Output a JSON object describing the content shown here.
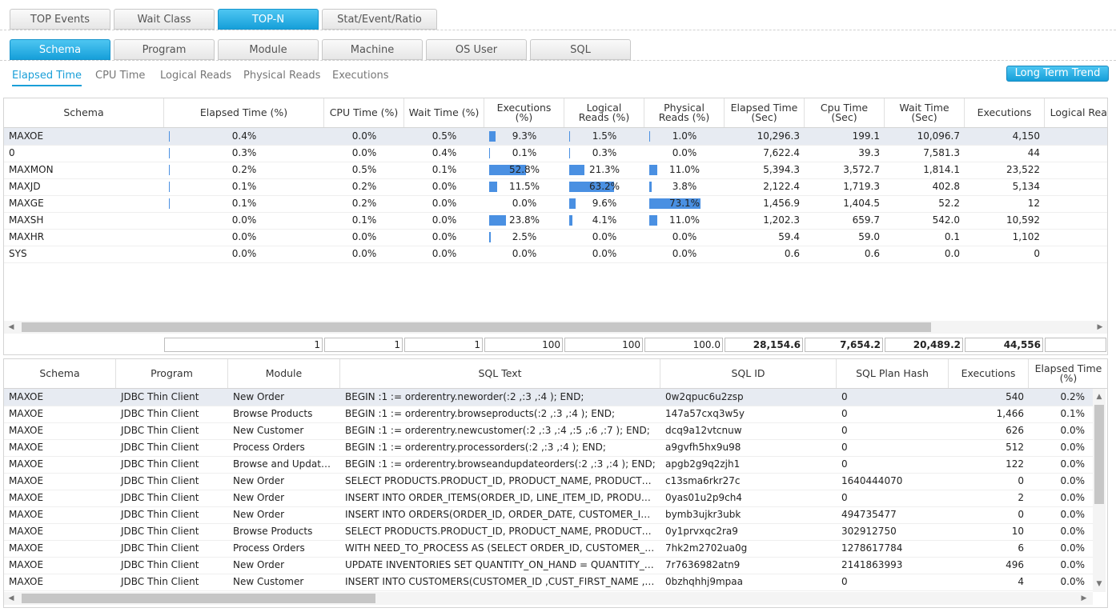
{
  "top_tabs": [
    "TOP Events",
    "Wait Class",
    "TOP-N",
    "Stat/Event/Ratio"
  ],
  "top_active": 2,
  "group_tabs": [
    "Schema",
    "Program",
    "Module",
    "Machine",
    "OS User",
    "SQL"
  ],
  "group_active": 0,
  "metric_tabs": [
    "Elapsed Time",
    "CPU Time",
    "Logical Reads",
    "Physical Reads",
    "Executions"
  ],
  "metric_active": 0,
  "long_term_trend": "Long Term Trend",
  "accent_color": "#1a9fd8",
  "bar_color": "#4a90e2",
  "schema_grid": {
    "columns": [
      "Schema",
      "Elapsed Time (%)",
      "CPU Time (%)",
      "Wait Time (%)",
      "Executions\n(%)",
      "Logical\nReads (%)",
      "Physical\nReads (%)",
      "Elapsed Time\n(Sec)",
      "Cpu Time\n(Sec)",
      "Wait Time\n(Sec)",
      "Executions",
      "Logical Reads"
    ],
    "rows": [
      {
        "schema": "MAXOE",
        "elapsed": "0.4%",
        "elapsed_v": 0.4,
        "cpu": "0.0%",
        "wait": "0.5%",
        "exec_pct": "9.3%",
        "exec_v": 9.3,
        "lr_pct": "1.5%",
        "lr_v": 1.5,
        "pr_pct": "1.0%",
        "pr_v": 1.0,
        "elapsed_sec": "10,296.3",
        "cpu_sec": "199.1",
        "wait_sec": "10,096.7",
        "executions": "4,150"
      },
      {
        "schema": "0",
        "elapsed": "0.3%",
        "elapsed_v": 0.3,
        "cpu": "0.0%",
        "wait": "0.4%",
        "exec_pct": "0.1%",
        "exec_v": 0.1,
        "lr_pct": "0.3%",
        "lr_v": 0.3,
        "pr_pct": "0.0%",
        "pr_v": 0,
        "elapsed_sec": "7,622.4",
        "cpu_sec": "39.3",
        "wait_sec": "7,581.3",
        "executions": "44"
      },
      {
        "schema": "MAXMON",
        "elapsed": "0.2%",
        "elapsed_v": 0.2,
        "cpu": "0.5%",
        "wait": "0.1%",
        "exec_pct": "52.8%",
        "exec_v": 52.8,
        "lr_pct": "21.3%",
        "lr_v": 21.3,
        "pr_pct": "11.0%",
        "pr_v": 11.0,
        "elapsed_sec": "5,394.3",
        "cpu_sec": "3,572.7",
        "wait_sec": "1,814.1",
        "executions": "23,522"
      },
      {
        "schema": "MAXJD",
        "elapsed": "0.1%",
        "elapsed_v": 0.1,
        "cpu": "0.2%",
        "wait": "0.0%",
        "exec_pct": "11.5%",
        "exec_v": 11.5,
        "lr_pct": "63.2%",
        "lr_v": 63.2,
        "pr_pct": "3.8%",
        "pr_v": 3.8,
        "elapsed_sec": "2,122.4",
        "cpu_sec": "1,719.3",
        "wait_sec": "402.8",
        "executions": "5,134"
      },
      {
        "schema": "MAXGE",
        "elapsed": "0.1%",
        "elapsed_v": 0.1,
        "cpu": "0.2%",
        "wait": "0.0%",
        "exec_pct": "0.0%",
        "exec_v": 0,
        "lr_pct": "9.6%",
        "lr_v": 9.6,
        "pr_pct": "73.1%",
        "pr_v": 73.1,
        "elapsed_sec": "1,456.9",
        "cpu_sec": "1,404.5",
        "wait_sec": "52.2",
        "executions": "12"
      },
      {
        "schema": "MAXSH",
        "elapsed": "0.0%",
        "elapsed_v": 0,
        "cpu": "0.1%",
        "wait": "0.0%",
        "exec_pct": "23.8%",
        "exec_v": 23.8,
        "lr_pct": "4.1%",
        "lr_v": 4.1,
        "pr_pct": "11.0%",
        "pr_v": 11.0,
        "elapsed_sec": "1,202.3",
        "cpu_sec": "659.7",
        "wait_sec": "542.0",
        "executions": "10,592"
      },
      {
        "schema": "MAXHR",
        "elapsed": "0.0%",
        "elapsed_v": 0,
        "cpu": "0.0%",
        "wait": "0.0%",
        "exec_pct": "2.5%",
        "exec_v": 2.5,
        "lr_pct": "0.0%",
        "lr_v": 0,
        "pr_pct": "0.0%",
        "pr_v": 0,
        "elapsed_sec": "59.4",
        "cpu_sec": "59.0",
        "wait_sec": "0.1",
        "executions": "1,102"
      },
      {
        "schema": "SYS",
        "elapsed": "0.0%",
        "elapsed_v": 0,
        "cpu": "0.0%",
        "wait": "0.0%",
        "exec_pct": "0.0%",
        "exec_v": 0,
        "lr_pct": "0.0%",
        "lr_v": 0,
        "pr_pct": "0.0%",
        "pr_v": 0,
        "elapsed_sec": "0.6",
        "cpu_sec": "0.6",
        "wait_sec": "0.0",
        "executions": "0"
      }
    ],
    "selected_row": 0,
    "totals": [
      "1",
      "1",
      "1",
      "100",
      "100",
      "100.0",
      "28,154.6",
      "7,654.2",
      "20,489.2",
      "44,556",
      ""
    ]
  },
  "sql_grid": {
    "columns": [
      "Schema",
      "Program",
      "Module",
      "SQL Text",
      "SQL ID",
      "SQL Plan Hash",
      "Executions",
      "Elapsed Time\n(%)"
    ],
    "rows": [
      [
        "MAXOE",
        "JDBC Thin Client",
        "New Order",
        "BEGIN :1 := orderentry.neworder(:2 ,:3 ,:4 ); END;",
        "0w2qpuc6u2zsp",
        "0",
        "540",
        "0.2%"
      ],
      [
        "MAXOE",
        "JDBC Thin Client",
        "Browse Products",
        "BEGIN :1 := orderentry.browseproducts(:2 ,:3 ,:4 ); END;",
        "147a57cxq3w5y",
        "0",
        "1,466",
        "0.1%"
      ],
      [
        "MAXOE",
        "JDBC Thin Client",
        "New Customer",
        "BEGIN :1 := orderentry.newcustomer(:2 ,:3 ,:4 ,:5 ,:6 ,:7 ); END;",
        "dcq9a12vtcnuw",
        "0",
        "626",
        "0.0%"
      ],
      [
        "MAXOE",
        "JDBC Thin Client",
        "Process Orders",
        "BEGIN :1 := orderentry.processorders(:2 ,:3 ,:4 ); END;",
        "a9gvfh5hx9u98",
        "0",
        "512",
        "0.0%"
      ],
      [
        "MAXOE",
        "JDBC Thin Client",
        "Browse and Update O...",
        "BEGIN :1 := orderentry.browseandupdateorders(:2 ,:3 ,:4 ); END;",
        "apgb2g9q2zjh1",
        "0",
        "122",
        "0.0%"
      ],
      [
        "MAXOE",
        "JDBC Thin Client",
        "New Order",
        "SELECT PRODUCTS.PRODUCT_ID, PRODUCT_NAME, PRODUCT_DESCRI...",
        "c13sma6rkr27c",
        "1640444070",
        "0",
        "0.0%"
      ],
      [
        "MAXOE",
        "JDBC Thin Client",
        "New Order",
        "INSERT INTO ORDER_ITEMS(ORDER_ID, LINE_ITEM_ID, PRODUCT_ID, U...",
        "0yas01u2p9ch4",
        "0",
        "2",
        "0.0%"
      ],
      [
        "MAXOE",
        "JDBC Thin Client",
        "New Order",
        "INSERT INTO ORDERS(ORDER_ID, ORDER_DATE, CUSTOMER_ID, WARE...",
        "bymb3ujkr3ubk",
        "494735477",
        "0",
        "0.0%"
      ],
      [
        "MAXOE",
        "JDBC Thin Client",
        "Browse Products",
        "SELECT PRODUCTS.PRODUCT_ID, PRODUCT_NAME, PRODUCT_DESCRI...",
        "0y1prvxqc2ra9",
        "302912750",
        "10",
        "0.0%"
      ],
      [
        "MAXOE",
        "JDBC Thin Client",
        "Process Orders",
        "WITH NEED_TO_PROCESS AS (SELECT ORDER_ID, CUSTOMER_ID FROM...",
        "7hk2m2702ua0g",
        "1278617784",
        "6",
        "0.0%"
      ],
      [
        "MAXOE",
        "JDBC Thin Client",
        "New Order",
        "UPDATE INVENTORIES SET QUANTITY_ON_HAND = QUANTITY_ON_HA...",
        "7r7636982atn9",
        "2141863993",
        "496",
        "0.0%"
      ],
      [
        "MAXOE",
        "JDBC Thin Client",
        "New Customer",
        "INSERT INTO CUSTOMERS(CUSTOMER_ID ,CUST_FIRST_NAME ,CUST_...",
        "0bzhqhhj9mpaa",
        "0",
        "4",
        "0.0%"
      ]
    ],
    "selected_row": 0
  }
}
